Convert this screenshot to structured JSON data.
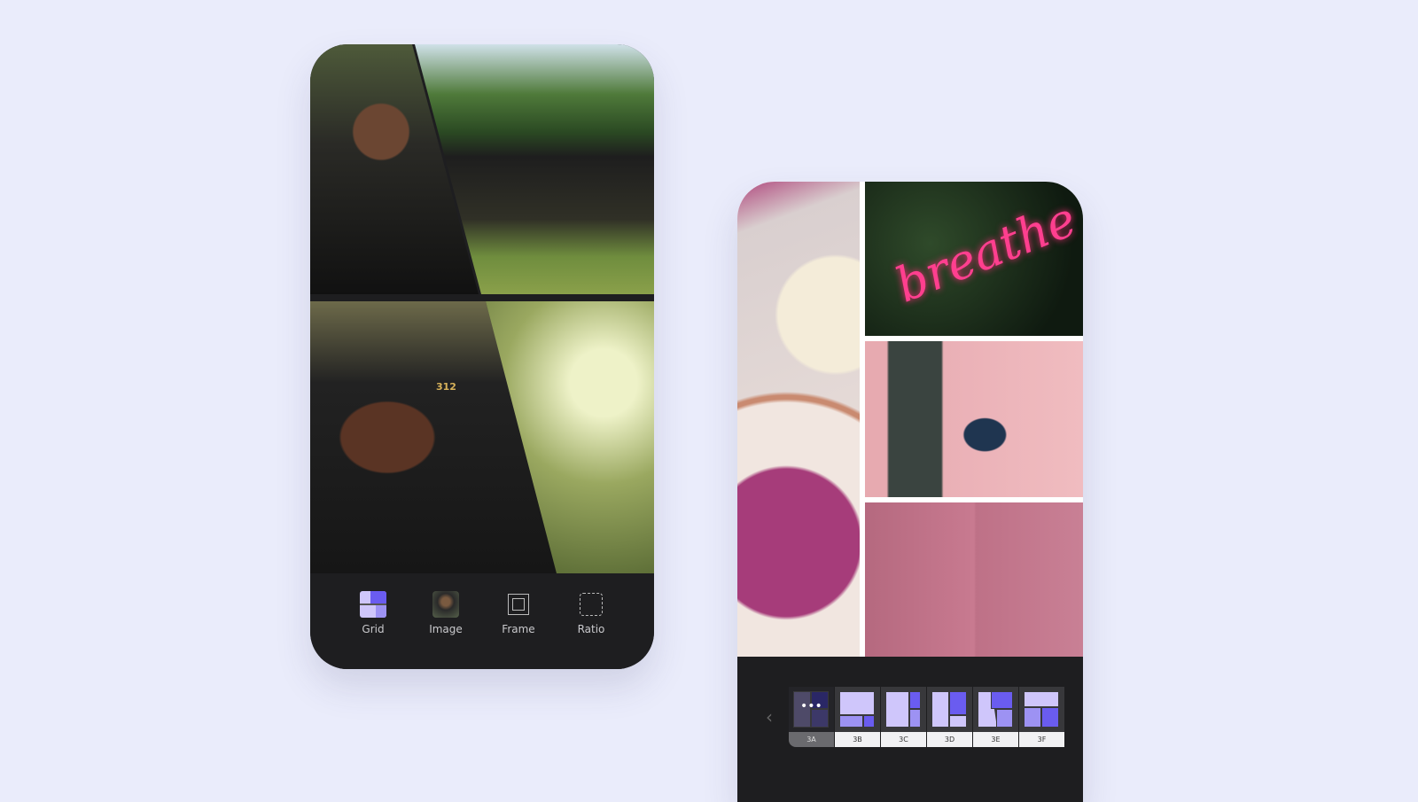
{
  "left_phone": {
    "toolbar": [
      {
        "label": "Grid",
        "icon": "grid-layout-icon"
      },
      {
        "label": "Image",
        "icon": "image-thumbnail-icon"
      },
      {
        "label": "Frame",
        "icon": "frame-icon"
      },
      {
        "label": "Ratio",
        "icon": "ratio-icon"
      }
    ],
    "photo_text": "312"
  },
  "right_phone": {
    "neon_text": "breathe",
    "layouts": [
      {
        "label": "3A",
        "selected": true
      },
      {
        "label": "3B"
      },
      {
        "label": "3C"
      },
      {
        "label": "3D"
      },
      {
        "label": "3E"
      },
      {
        "label": "3F"
      }
    ]
  },
  "colors": {
    "accent": "#6a5cf0",
    "accent_light": "#cfc6fb",
    "background": "#eaecfb",
    "panel": "#1e1e20"
  }
}
